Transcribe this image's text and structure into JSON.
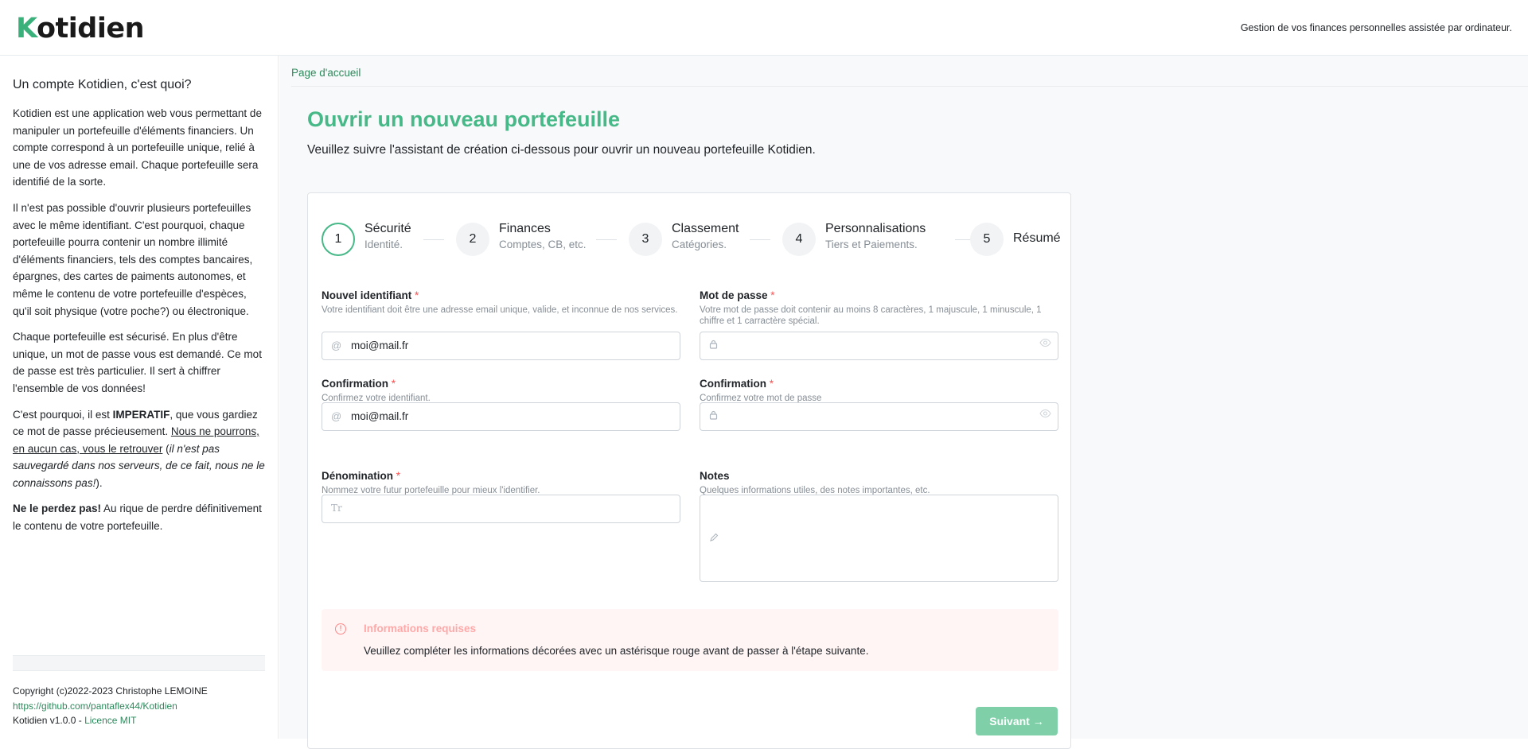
{
  "header": {
    "logo_first": "K",
    "logo_rest": "otidien",
    "tagline": "Gestion de vos finances personnelles assistée par ordinateur."
  },
  "sidebar": {
    "title": "Un compte Kotidien, c'est quoi?",
    "p1": "Kotidien est une application web vous permettant de manipuler un portefeuille d'éléments financiers. Un compte correspond à un portefeuille unique, relié à une de vos adresse email. Chaque portefeuille sera identifié de la sorte.",
    "p2": "Il n'est pas possible d'ouvrir plusieurs portefeuilles avec le même identifiant. C'est pourquoi, chaque portefeuille pourra contenir un nombre illimité d'éléments financiers, tels des comptes bancaires, épargnes, des cartes de paiments autonomes, et même le contenu de votre portefeuille d'espèces, qu'il soit physique (votre poche?) ou électronique.",
    "p3": "Chaque portefeuille est sécurisé. En plus d'être unique, un mot de passe vous est demandé. Ce mot de passe est très particulier. Il sert à chiffrer l'ensemble de vos données!",
    "p4_a": "C'est pourquoi, il est ",
    "p4_b": "IMPERATIF",
    "p4_c": ", que vous gardiez ce mot de passe précieusement. ",
    "p4_d": "Nous ne pourrons, en aucun cas, vous le retrouver",
    "p4_e": " (",
    "p4_f": "il n'est pas sauvegardé dans nos serveurs, de ce fait, nous ne le connaissons pas!",
    "p4_g": ").",
    "p5_a": "Ne le perdez pas!",
    "p5_b": " Au rique de perdre définitivement le contenu de votre portefeuille.",
    "copyright": "Copyright (c)2022-2023 Christophe LEMOINE",
    "github": "https://github.com/pantaflex44/Kotidien",
    "version": "Kotidien v1.0.0 - ",
    "license": "Licence MIT"
  },
  "main": {
    "breadcrumb": "Page d'accueil",
    "title": "Ouvrir un nouveau portefeuille",
    "subtitle": "Veuillez suivre l'assistant de création ci-dessous pour ouvrir un nouveau portefeuille Kotidien."
  },
  "steps": [
    {
      "num": "1",
      "title": "Sécurité",
      "desc": "Identité."
    },
    {
      "num": "2",
      "title": "Finances",
      "desc": "Comptes, CB, etc."
    },
    {
      "num": "3",
      "title": "Classement",
      "desc": "Catégories."
    },
    {
      "num": "4",
      "title": "Personnalisations",
      "desc": "Tiers et Paiements."
    },
    {
      "num": "5",
      "title": "Résumé",
      "desc": ""
    }
  ],
  "form": {
    "identifier_label": "Nouvel identifiant",
    "identifier_desc": "Votre identifiant doit être une adresse email unique, valide, et inconnue de nos services.",
    "identifier_value": "moi@mail.fr",
    "password_label": "Mot de passe",
    "password_desc": "Votre mot de passe doit contenir au moins 8 caractères, 1 majuscule, 1 minuscule, 1 chiffre et 1 carractère spécial.",
    "id_confirm_label": "Confirmation",
    "id_confirm_desc": "Confirmez votre identifiant.",
    "id_confirm_value": "moi@mail.fr",
    "pw_confirm_label": "Confirmation",
    "pw_confirm_desc": "Confirmez votre mot de passe",
    "name_label": "Dénomination",
    "name_desc": "Nommez votre futur portefeuille pour mieux l'identifier.",
    "name_icon_text": "Tr",
    "notes_label": "Notes",
    "notes_desc": "Quelques informations utiles, des notes importantes, etc.",
    "required_mark": "*"
  },
  "alert": {
    "title": "Informations requises",
    "text": "Veuillez compléter les informations décorées avec un astérisque rouge avant de passer à l'étape suivante."
  },
  "buttons": {
    "next": "Suivant →"
  },
  "icons": {
    "at": "at-icon",
    "lock": "lock-icon",
    "eye": "eye-icon",
    "text": "text-icon",
    "pencil": "pencil-icon",
    "alert": "alert-circle-icon"
  },
  "colors": {
    "brand": "#47b887",
    "link": "#2b8a5b",
    "required": "#fa5252",
    "alert_bg": "#fff5f5",
    "alert_title": "#ffa8a8",
    "button": "#7fd0a9"
  }
}
